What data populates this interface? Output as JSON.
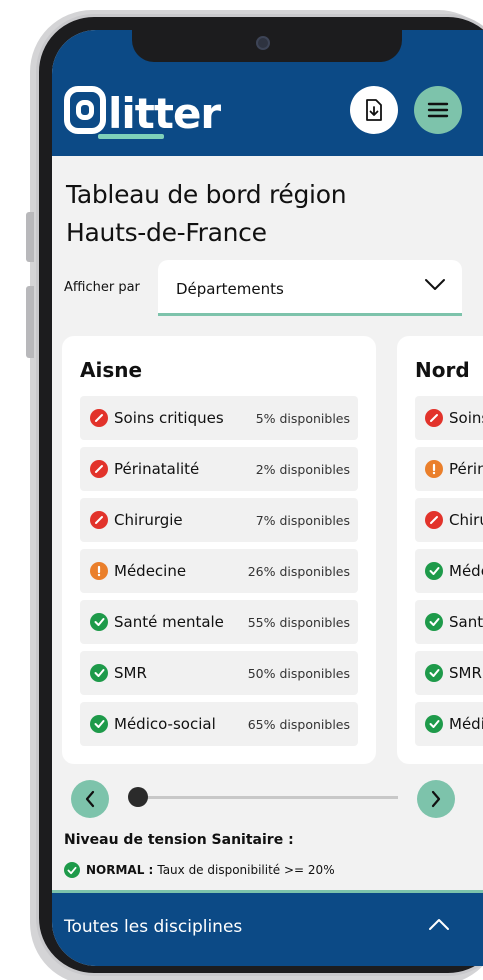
{
  "app": {
    "logo_text": "litter"
  },
  "page": {
    "title": "Tableau de bord région Hauts-de-France"
  },
  "filter": {
    "label": "Afficher par",
    "selected": "Départements"
  },
  "cards": [
    {
      "name": "Aisne",
      "rows": [
        {
          "label": "Soins critiques",
          "value": "5% disponibles",
          "status": "critical"
        },
        {
          "label": "Périnatalité",
          "value": "2% disponibles",
          "status": "critical"
        },
        {
          "label": "Chirurgie",
          "value": "7% disponibles",
          "status": "critical"
        },
        {
          "label": "Médecine",
          "value": "26% disponibles",
          "status": "warning"
        },
        {
          "label": "Santé mentale",
          "value": "55% disponibles",
          "status": "ok"
        },
        {
          "label": "SMR",
          "value": "50% disponibles",
          "status": "ok"
        },
        {
          "label": "Médico-social",
          "value": "65% disponibles",
          "status": "ok"
        }
      ]
    },
    {
      "name": "Nord",
      "rows": [
        {
          "label": "Soins critiques",
          "status": "critical"
        },
        {
          "label": "Périnatalité",
          "status": "warning"
        },
        {
          "label": "Chirurgie",
          "status": "critical"
        },
        {
          "label": "Médecine",
          "status": "ok"
        },
        {
          "label": "Santé mentale",
          "status": "ok"
        },
        {
          "label": "SMR",
          "status": "ok"
        },
        {
          "label": "Médico-social",
          "status": "ok"
        }
      ]
    }
  ],
  "pager": {
    "position": 0
  },
  "legend": {
    "title": "Niveau de tension Sanitaire :",
    "items": [
      {
        "keyword": "NORMAL :",
        "text": "Taux de disponibilité >= 20%",
        "status": "ok"
      }
    ]
  },
  "bottom_bar": {
    "label": "Toutes les disciplines"
  },
  "colors": {
    "header": "#0c4a86",
    "accent": "#7dc3ab",
    "critical": "#e2332b",
    "warning": "#ea7f2b",
    "ok": "#1e9a4a"
  },
  "icons": {
    "download": "download-icon",
    "menu": "hamburger-menu-icon",
    "chevron_down": "chevron-down-icon",
    "chevron_left": "chevron-left-icon",
    "chevron_right": "chevron-right-icon",
    "chevron_up": "chevron-up-icon",
    "critical": "critical-status-icon",
    "warning": "warning-status-icon",
    "ok": "check-status-icon"
  }
}
